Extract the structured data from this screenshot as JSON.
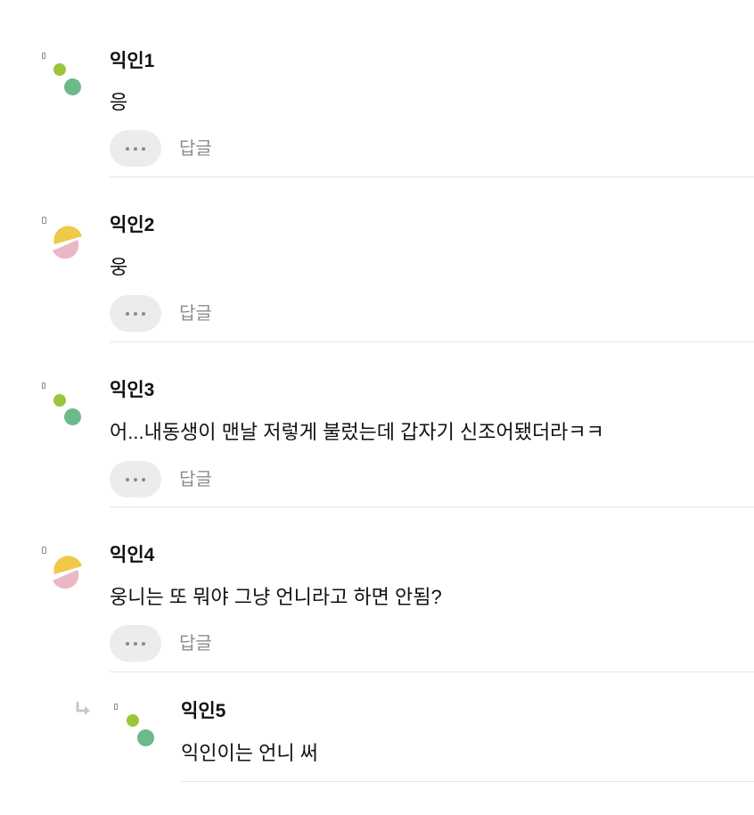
{
  "comments": [
    {
      "author": "익인1",
      "text": "응",
      "avatar": "green-dots-avatar",
      "reply_label": "답글"
    },
    {
      "author": "익인2",
      "text": "웅",
      "avatar": "yellow-pink-avatar",
      "reply_label": "답글"
    },
    {
      "author": "익인3",
      "text": "어...내동생이 맨날 저렇게 불렀는데 갑자기 신조어됐더라ㅋㅋ",
      "avatar": "green-dots-avatar",
      "reply_label": "답글"
    },
    {
      "author": "익인4",
      "text": "웅니는 또 뭐야 그냥 언니라고 하면 안됨?",
      "avatar": "yellow-pink-avatar",
      "reply_label": "답글"
    }
  ],
  "reply": {
    "author": "익인5",
    "text": "익인이는 언니 써",
    "avatar": "green-dots-avatar",
    "icon": "reply-arrow-icon"
  },
  "colors": {
    "green_light": "#9bc53d",
    "green_dark": "#6cb98a",
    "yellow": "#f0c94a",
    "pink": "#ecb7c4",
    "divider": "#e6e6e6",
    "more_button_bg": "#ececec",
    "reply_text": "#8c8c8c"
  }
}
